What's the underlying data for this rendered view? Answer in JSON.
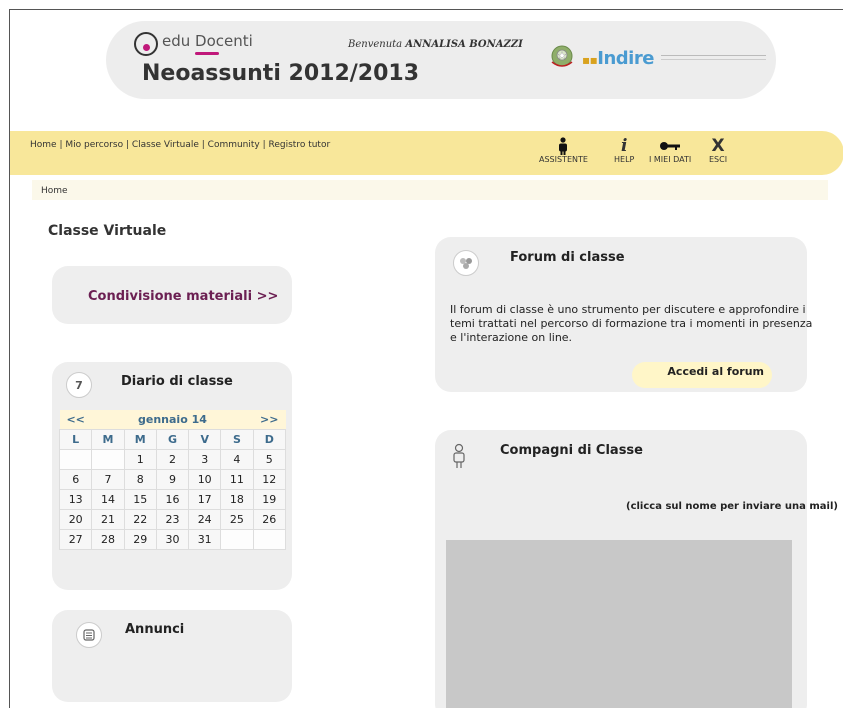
{
  "header": {
    "logo_text": "edu Docenti",
    "site_title": "Neoassunti 2012/2013",
    "welcome_prefix": "Benvenuta",
    "user_name": "ANNALISA BONAZZI",
    "indire_logo": "Indire"
  },
  "nav": {
    "links": [
      "Home",
      "Mio percorso",
      "Classe Virtuale",
      "Community",
      "Registro tutor"
    ],
    "tools": [
      {
        "label": "ASSISTENTE",
        "icon": "person-icon"
      },
      {
        "label": "HELP",
        "icon": "info-icon"
      },
      {
        "label": "I MIEI DATI",
        "icon": "key-icon"
      },
      {
        "label": "ESCI",
        "icon": "close-icon"
      }
    ]
  },
  "breadcrumb": "Home",
  "page_heading": "Classe Virtuale",
  "condivisione": {
    "label": "Condivisione materiali >>"
  },
  "diario": {
    "title": "Diario di classe",
    "icon_day": "7",
    "prev": "<<",
    "next": ">>",
    "month": "gennaio 14",
    "weekdays": [
      "L",
      "M",
      "M",
      "G",
      "V",
      "S",
      "D"
    ],
    "weeks": [
      [
        "",
        "",
        "1",
        "2",
        "3",
        "4",
        "5"
      ],
      [
        "6",
        "7",
        "8",
        "9",
        "10",
        "11",
        "12"
      ],
      [
        "13",
        "14",
        "15",
        "16",
        "17",
        "18",
        "19"
      ],
      [
        "20",
        "21",
        "22",
        "23",
        "24",
        "25",
        "26"
      ],
      [
        "27",
        "28",
        "29",
        "30",
        "31",
        "",
        ""
      ]
    ]
  },
  "annunci": {
    "title": "Annunci"
  },
  "forum": {
    "title": "Forum di classe",
    "text": "Il forum di classe è uno strumento per discutere e approfondire i temi trattati nel percorso di formazione tra i momenti in presenza e l'interazione on line.",
    "button": "Accedi al forum"
  },
  "compagni": {
    "title": "Compagni di Classe",
    "hint": "(clicca sul nome per inviare una mail)"
  },
  "colors": {
    "nav_bg": "#f8e79a",
    "panel_bg": "#eeeeee",
    "accent_purple": "#6b1f52",
    "calendar_blue": "#3d6b8c"
  }
}
